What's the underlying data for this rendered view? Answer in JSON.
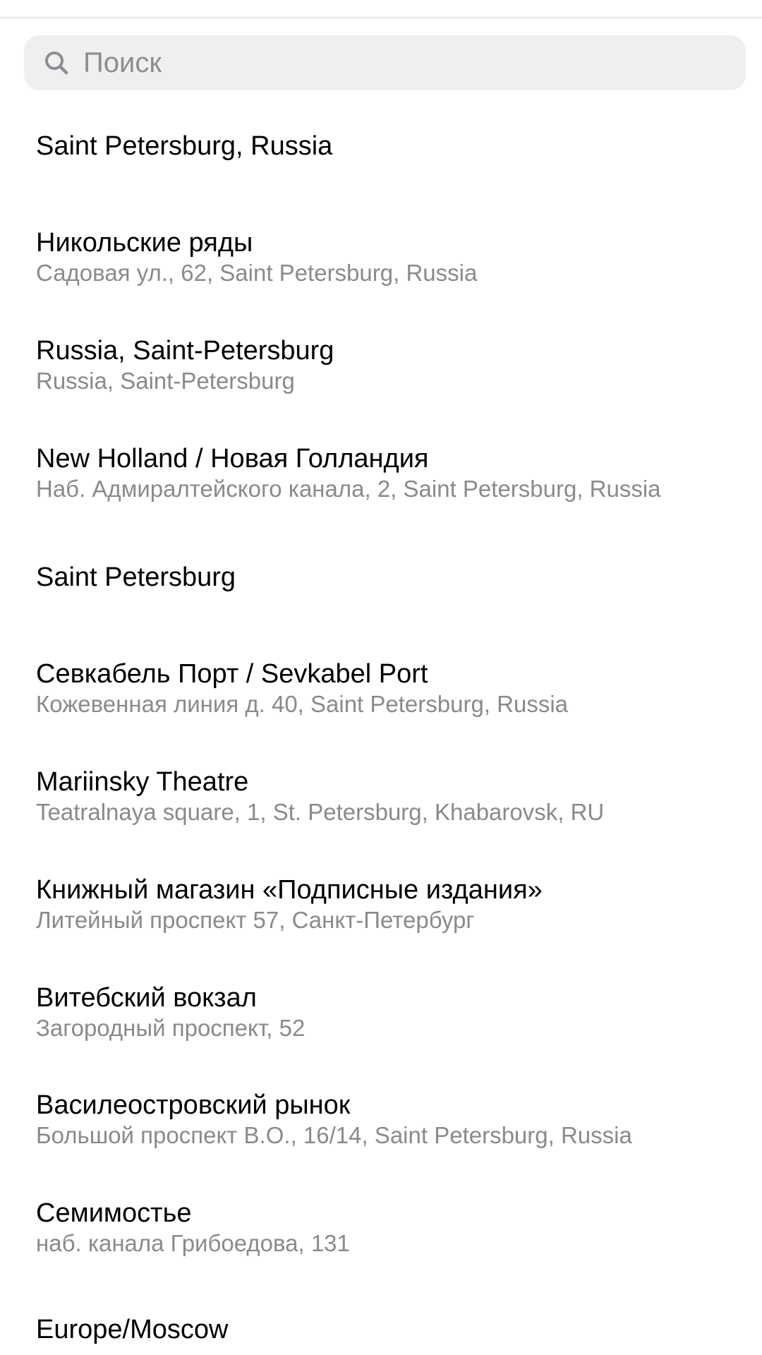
{
  "search": {
    "placeholder": "Поиск",
    "value": ""
  },
  "results": [
    {
      "title": "Saint Petersburg, Russia",
      "subtitle": ""
    },
    {
      "title": "Никольские ряды",
      "subtitle": "Садовая ул., 62, Saint Petersburg, Russia"
    },
    {
      "title": "Russia, Saint-Petersburg",
      "subtitle": "Russia, Saint-Petersburg"
    },
    {
      "title": "New Holland / Новая Голландия",
      "subtitle": "Наб. Адмиралтейского канала, 2, Saint Petersburg, Russia"
    },
    {
      "title": "Saint Petersburg",
      "subtitle": ""
    },
    {
      "title": "Севкабель Порт / Sevkabel Port",
      "subtitle": "Кожевенная линия д. 40, Saint Petersburg, Russia"
    },
    {
      "title": "Mariinsky Theatre",
      "subtitle": "Teatralnaya square, 1, St. Petersburg, Khabarovsk, RU"
    },
    {
      "title": "Книжный магазин «Подписные издания»",
      "subtitle": "Литейный проспект 57, Санкт-Петербург"
    },
    {
      "title": "Витебский вокзал",
      "subtitle": "Загородный проспект, 52"
    },
    {
      "title": "Василеостровский рынок",
      "subtitle": "Большой проспект В.О., 16/14, Saint Petersburg, Russia"
    },
    {
      "title": "Семимостье",
      "subtitle": "наб. канала Грибоедова, 131"
    },
    {
      "title": "Europe/Moscow",
      "subtitle": ""
    }
  ],
  "colors": {
    "search_background": "#efeff0",
    "placeholder": "#8d8d92",
    "subtitle": "#8a8a8e",
    "title": "#000000"
  },
  "icons": {
    "search": "magnifying-glass"
  }
}
